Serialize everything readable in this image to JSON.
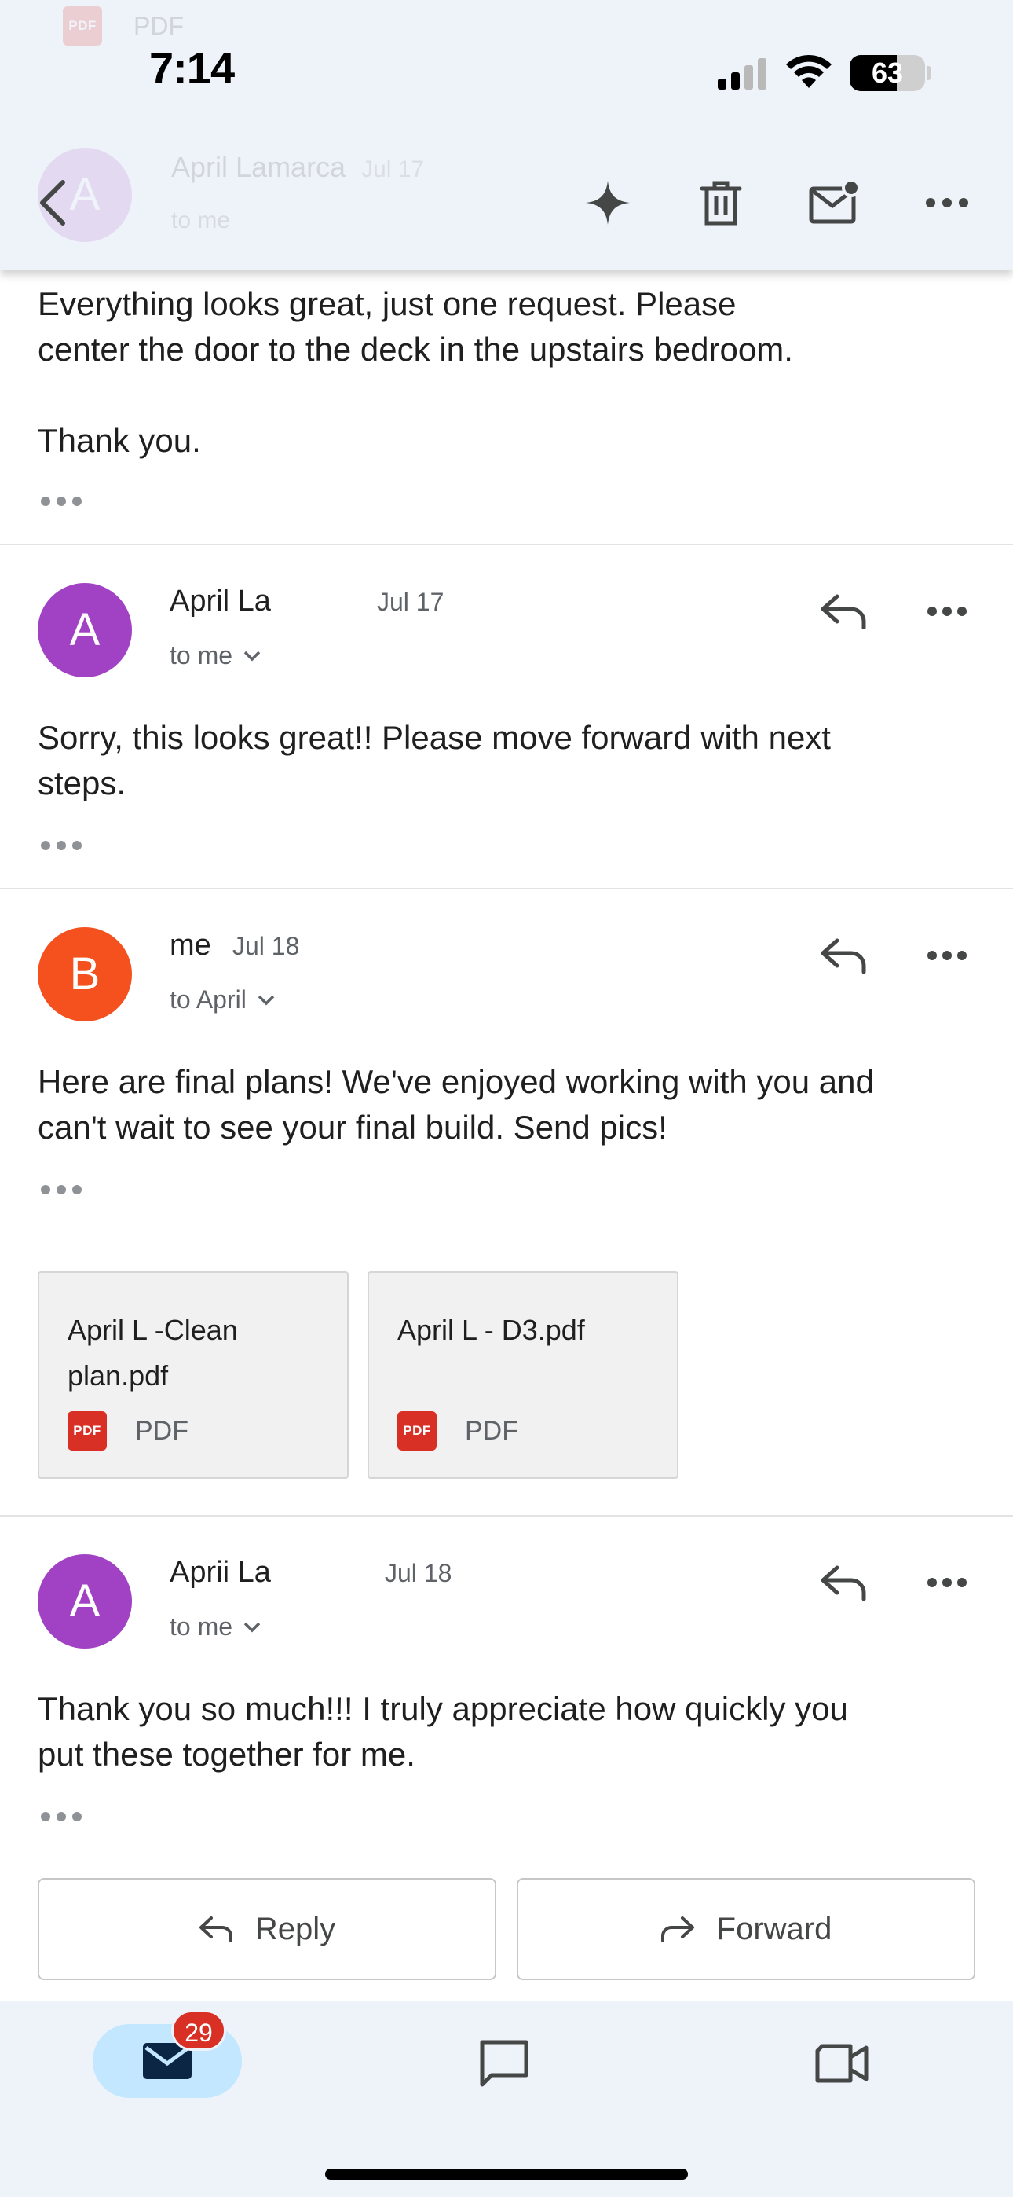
{
  "status_bar": {
    "time": "7:14",
    "battery_percent": "63",
    "battery_level": 0.63
  },
  "header_ghost": {
    "attachment_type": "PDF",
    "avatar_letter": "A",
    "sender": "April Lamarca",
    "date": "Jul 17",
    "recipient": "to me"
  },
  "toolbar": {
    "back": "back-icon",
    "gemini": "sparkle-icon",
    "delete": "trash-icon",
    "mark_unread": "mail-unread-icon",
    "more": "more-icon"
  },
  "messages": [
    {
      "body_lines": [
        "Everything looks great, just one request. Please",
        "center the door to the deck in the upstairs bedroom.",
        "",
        "Thank you."
      ]
    },
    {
      "avatar_letter": "A",
      "avatar_color": "#a142c4",
      "sender": "April La",
      "date": "Jul 17",
      "recipient": "to me",
      "body_lines": [
        "Sorry, this looks great!! Please move forward with next",
        "steps."
      ]
    },
    {
      "avatar_letter": "B",
      "avatar_color": "#f4511e",
      "sender": "me",
      "date": "Jul 18",
      "recipient": "to April",
      "body_lines": [
        "Here are final plans! We've enjoyed working with you and",
        "can't wait to see your final build. Send pics!"
      ],
      "attachments": [
        {
          "name_lines": [
            "April L -Clean",
            "plan.pdf"
          ],
          "type": "PDF",
          "icon_label": "PDF"
        },
        {
          "name_lines": [
            "April L - D3.pdf"
          ],
          "type": "PDF",
          "icon_label": "PDF"
        }
      ]
    },
    {
      "avatar_letter": "A",
      "avatar_color": "#a142c4",
      "sender": "Aprii La",
      "date": "Jul 18",
      "recipient": "to me",
      "body_lines": [
        "Thank you so much!!! I truly appreciate how quickly you",
        "put these together for me."
      ]
    }
  ],
  "actions": {
    "reply_label": "Reply",
    "forward_label": "Forward"
  },
  "bottom_nav": {
    "mail_badge": "29",
    "items": [
      "mail-icon",
      "chat-icon",
      "meet-icon"
    ]
  },
  "colors": {
    "accent": "#c2e7ff",
    "badge": "#d93025",
    "pdf": "#d93025",
    "bar_bg": "#eef2f9"
  }
}
